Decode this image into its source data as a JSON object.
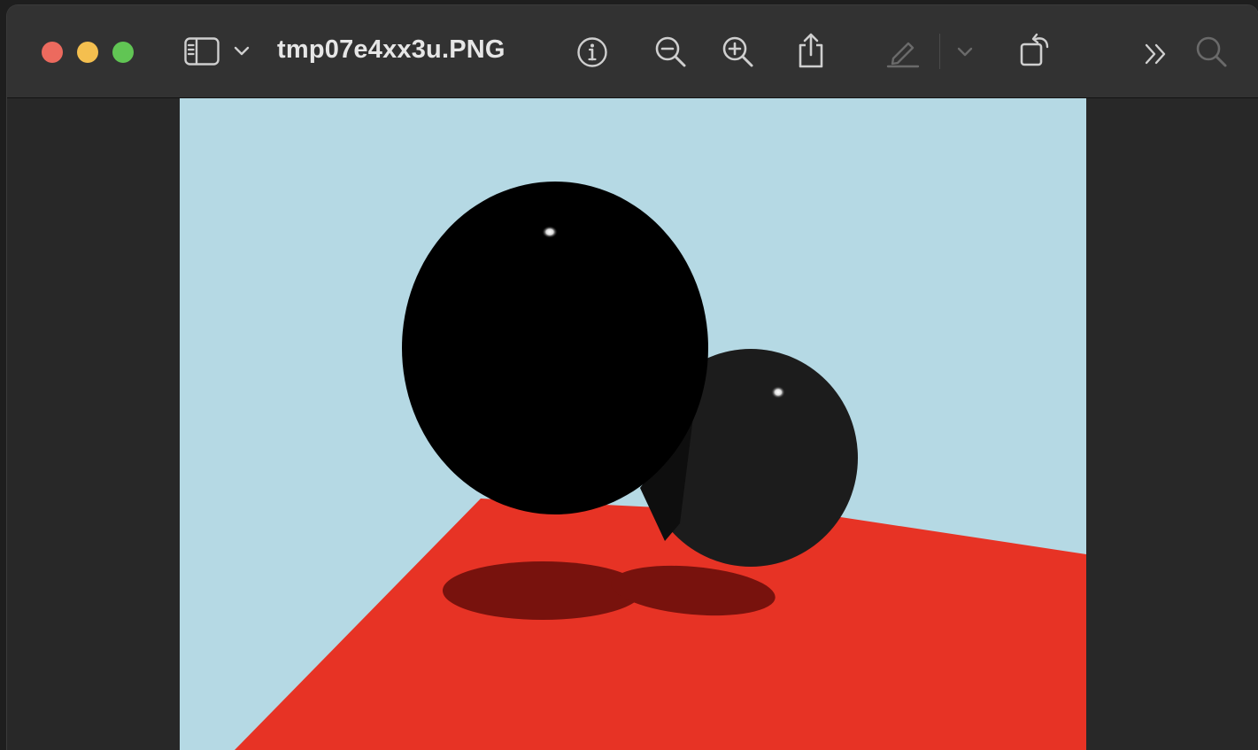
{
  "window": {
    "title": "tmp07e4xx3u.PNG"
  },
  "toolbar": {
    "traffic_lights": [
      {
        "name": "close",
        "color": "#ec6a5e"
      },
      {
        "name": "minimize",
        "color": "#f4bf4f"
      },
      {
        "name": "zoom",
        "color": "#61c554"
      }
    ],
    "icons": [
      "sidebar-icon",
      "chevron-down-icon",
      "info-icon",
      "zoom-out-icon",
      "zoom-in-icon",
      "share-icon",
      "markup-pen-icon",
      "markup-chevron-icon",
      "rotate-icon",
      "overflow-icon",
      "search-icon"
    ],
    "markup_enabled": false
  },
  "image": {
    "description": "rendered-scene",
    "colors": {
      "sky": "#b5d9e4",
      "floor": "#e73325",
      "floor_shadow": "#78120d",
      "sphere_large": "#000000",
      "sphere_small": "#1c1c1c",
      "highlight": "#ffffff",
      "canvas_margin": "#282828"
    }
  }
}
